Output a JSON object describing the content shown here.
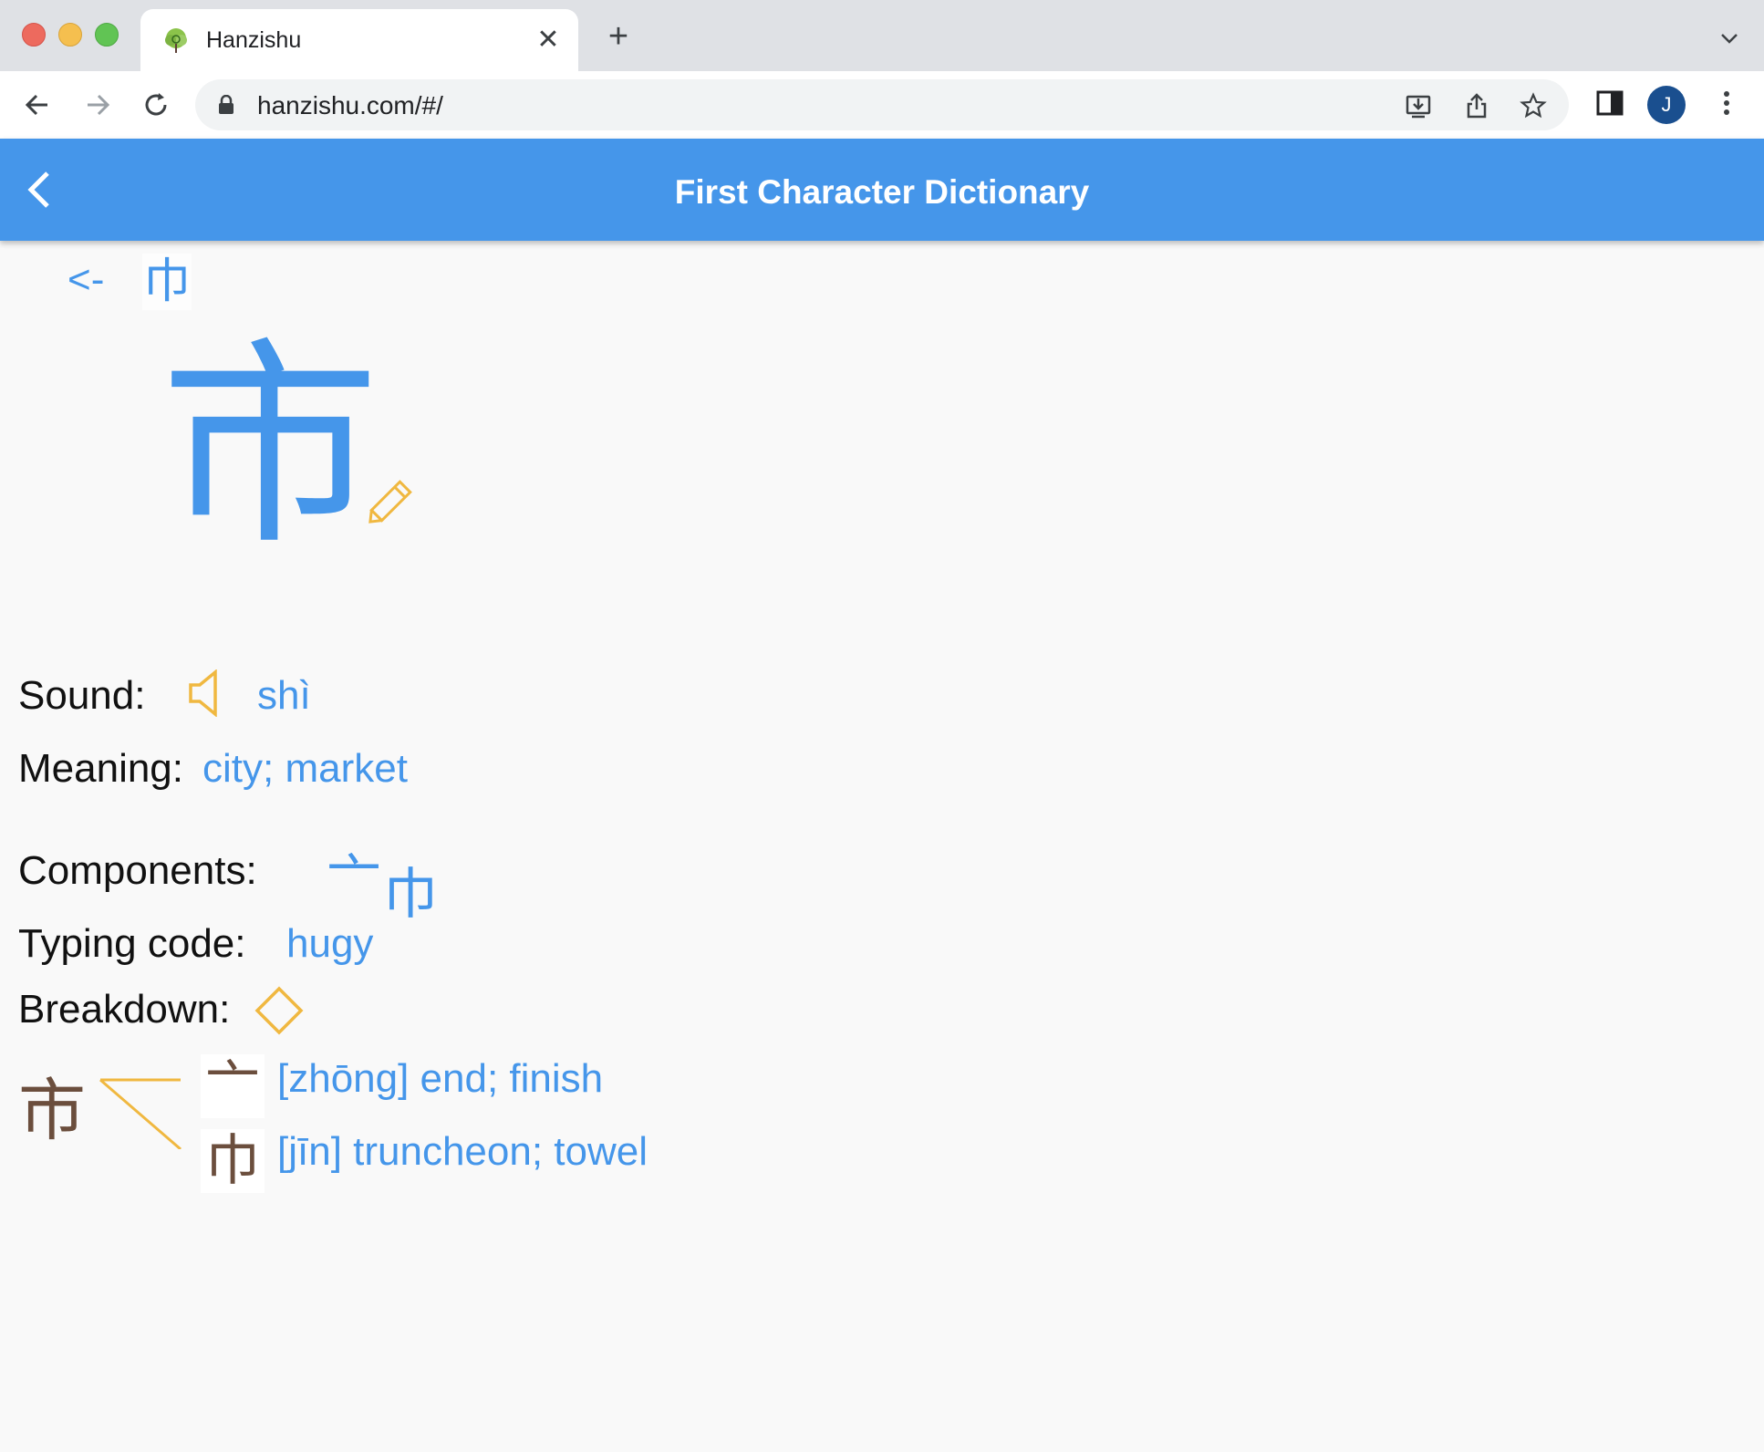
{
  "browser": {
    "tab_title": "Hanzishu",
    "new_tab_label": "+",
    "close_label": "✕",
    "url": "hanzishu.com/#/",
    "profile_initial": "J"
  },
  "app": {
    "title": "First Character Dictionary",
    "breadcrumb": {
      "arrow": "<-",
      "previous_char": "巾"
    },
    "character": "市",
    "sound_label": "Sound:",
    "sound_value": "shì",
    "meaning_label": "Meaning:",
    "meaning_value": "city; market",
    "components_label": "Components:",
    "components": [
      "亠",
      "巾"
    ],
    "typing_label": "Typing code:",
    "typing_value": "hugy",
    "breakdown_label": "Breakdown:",
    "breakdown": {
      "root": "市",
      "parts": [
        {
          "char": "亠",
          "definition": "[zhōng] end; finish"
        },
        {
          "char": "巾",
          "definition": "[jīn] truncheon; towel"
        }
      ]
    }
  },
  "colors": {
    "accent": "#4596ea",
    "icon_yellow": "#f0b840",
    "brown": "#6b4e3d"
  }
}
